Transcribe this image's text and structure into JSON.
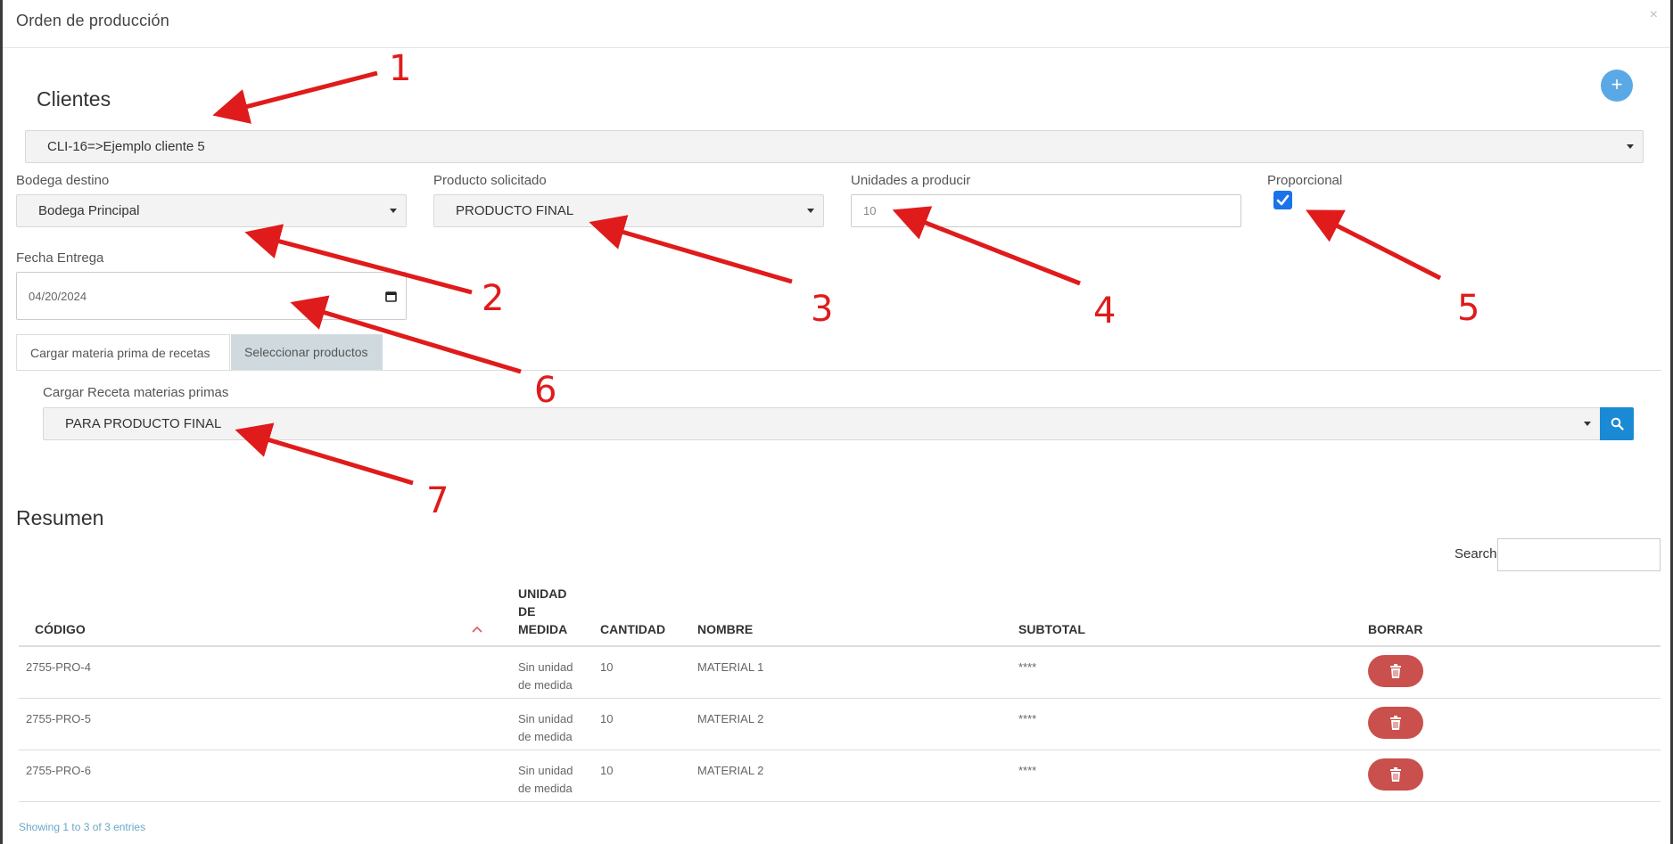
{
  "modal": {
    "title": "Orden de producción",
    "close": "×"
  },
  "clientes": {
    "heading": "Clientes",
    "selected": "CLI-16=>Ejemplo cliente 5",
    "add_icon": "plus-icon",
    "add_symbol": "+"
  },
  "bodega": {
    "label": "Bodega destino",
    "selected": "Bodega Principal"
  },
  "producto": {
    "label": "Producto solicitado",
    "selected": "PRODUCTO FINAL"
  },
  "unidades": {
    "label": "Unidades a producir",
    "value": "10"
  },
  "proporcional": {
    "label": "Proporcional",
    "checked": true
  },
  "fecha": {
    "label": "Fecha Entrega",
    "value": "04/20/2024"
  },
  "tabs": [
    {
      "label": "Cargar materia prima de recetas",
      "active": true
    },
    {
      "label": "Seleccionar productos",
      "active": false
    }
  ],
  "receta": {
    "label": "Cargar Receta materias primas",
    "selected": "PARA PRODUCTO FINAL"
  },
  "resumen": {
    "heading": "Resumen",
    "search_label": "Search:",
    "columns": [
      "CÓDIGO",
      "UNIDAD DE MEDIDA",
      "CANTIDAD",
      "NOMBRE",
      "SUBTOTAL",
      "BORRAR"
    ],
    "rows": [
      {
        "codigo": "2755-PRO-4",
        "unidad": "Sin unidad de medida",
        "cantidad": "10",
        "nombre": "MATERIAL 1",
        "subtotal": "****"
      },
      {
        "codigo": "2755-PRO-5",
        "unidad": "Sin unidad de medida",
        "cantidad": "10",
        "nombre": "MATERIAL 2",
        "subtotal": "****"
      },
      {
        "codigo": "2755-PRO-6",
        "unidad": "Sin unidad de medida",
        "cantidad": "10",
        "nombre": "MATERIAL 2",
        "subtotal": "****"
      }
    ],
    "footer": "Showing 1 to 3 of 3 entries"
  },
  "annotations": {
    "color": "#e01b1b",
    "numbers": [
      "1",
      "2",
      "3",
      "4",
      "5",
      "6",
      "7"
    ]
  },
  "colors": {
    "primary": "#1a8ad4",
    "danger": "#c9504c",
    "plus": "#5aa9e6",
    "checkbox": "#1a73e8"
  }
}
